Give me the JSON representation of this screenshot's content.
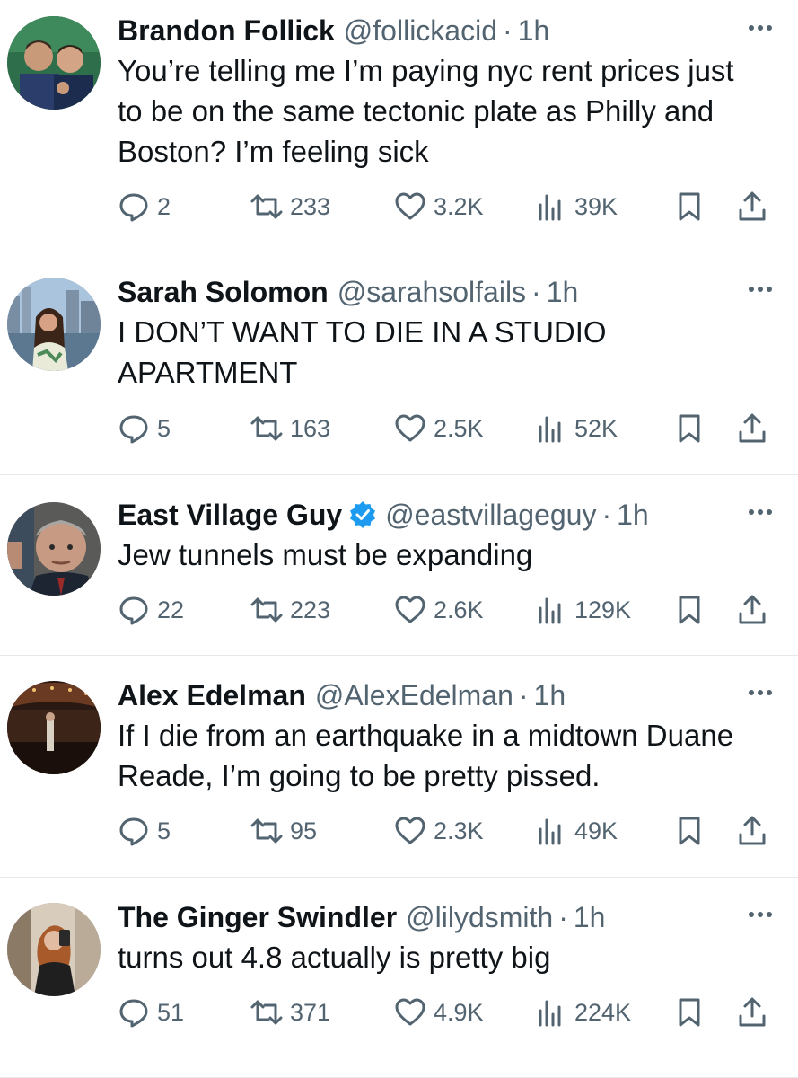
{
  "tweets": [
    {
      "name": "Brandon Follick",
      "handle": "@follickacid",
      "dot": "·",
      "time": "1h",
      "verified": false,
      "text_lines": [
        "You’re telling me I’m paying nyc rent prices just",
        "to be on the same tectonic plate as Philly and",
        "Boston? I’m feeling sick"
      ],
      "replies": "2",
      "retweets": "233",
      "likes": "3.2K",
      "views": "39K",
      "avatar": "avatar-two-men"
    },
    {
      "name": "Sarah Solomon",
      "handle": "@sarahsolfails",
      "dot": "·",
      "time": "1h",
      "verified": false,
      "text_lines": [
        "I DON’T WANT TO DIE IN A STUDIO",
        "APARTMENT"
      ],
      "replies": "5",
      "retweets": "163",
      "likes": "2.5K",
      "views": "52K",
      "avatar": "avatar-woman-city"
    },
    {
      "name": "East Village Guy",
      "handle": "@eastvillageguy",
      "dot": "·",
      "time": "1h",
      "verified": true,
      "text_lines": [
        "Jew tunnels must be expanding"
      ],
      "replies": "22",
      "retweets": "223",
      "likes": "2.6K",
      "views": "129K",
      "avatar": "avatar-man-suit"
    },
    {
      "name": "Alex Edelman",
      "handle": "@AlexEdelman",
      "dot": "·",
      "time": "1h",
      "verified": false,
      "text_lines": [
        "If I die from an earthquake in a midtown Duane",
        "Reade, I’m going to be pretty pissed."
      ],
      "replies": "5",
      "retweets": "95",
      "likes": "2.3K",
      "views": "49K",
      "avatar": "avatar-theater-stage"
    },
    {
      "name": "The Ginger Swindler",
      "handle": "@lilydsmith",
      "dot": "·",
      "time": "1h",
      "verified": false,
      "text_lines": [
        "turns out 4.8 actually is pretty big"
      ],
      "replies": "51",
      "retweets": "371",
      "likes": "4.9K",
      "views": "224K",
      "avatar": "avatar-mirror-selfie"
    }
  ],
  "colors": {
    "text": "#0f1419",
    "secondary": "#536471",
    "verified_blue": "#1d9bf0",
    "divider": "#e6e9ec"
  }
}
